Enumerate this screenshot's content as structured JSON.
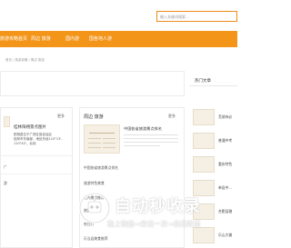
{
  "search": {
    "placeholder": "输入关键词搜索..."
  },
  "nav": {
    "items": [
      "旅游攻略首页",
      "周边 旅游",
      "国内游",
      "国各地人游"
    ]
  },
  "breadcrumb": "首页 / 旅游攻略 / 周边 旅游",
  "card_a": {
    "more": "更多",
    "item_title": "桂林阳朔景点图片",
    "excerpt": [
      "阳朔县位于广西壮族自治区",
      "桂林市东南部，地处东经110°13'-",
      "110°40'，北纬"
    ],
    "links": [
      "广",
      "游"
    ]
  },
  "card_b": {
    "title": "周边 旅游",
    "more": "更多",
    "lead": "中国各省旅游景点排名",
    "links": [
      "中国各省旅游景点排名",
      "旅游特色美食",
      "室内景点推荐",
      "旅游攻略",
      "吃住行",
      "乐当县美食推荐"
    ]
  },
  "sidebar": {
    "title": "热门文章",
    "items": [
      "芜湖市必",
      "普通中考",
      "重庆特色",
      "单县中...",
      "合肥县辖",
      "乐山大佛"
    ]
  },
  "watermark": {
    "title": "自动秒收录",
    "subtitle": "路上链接→来访一次→自动收录"
  }
}
